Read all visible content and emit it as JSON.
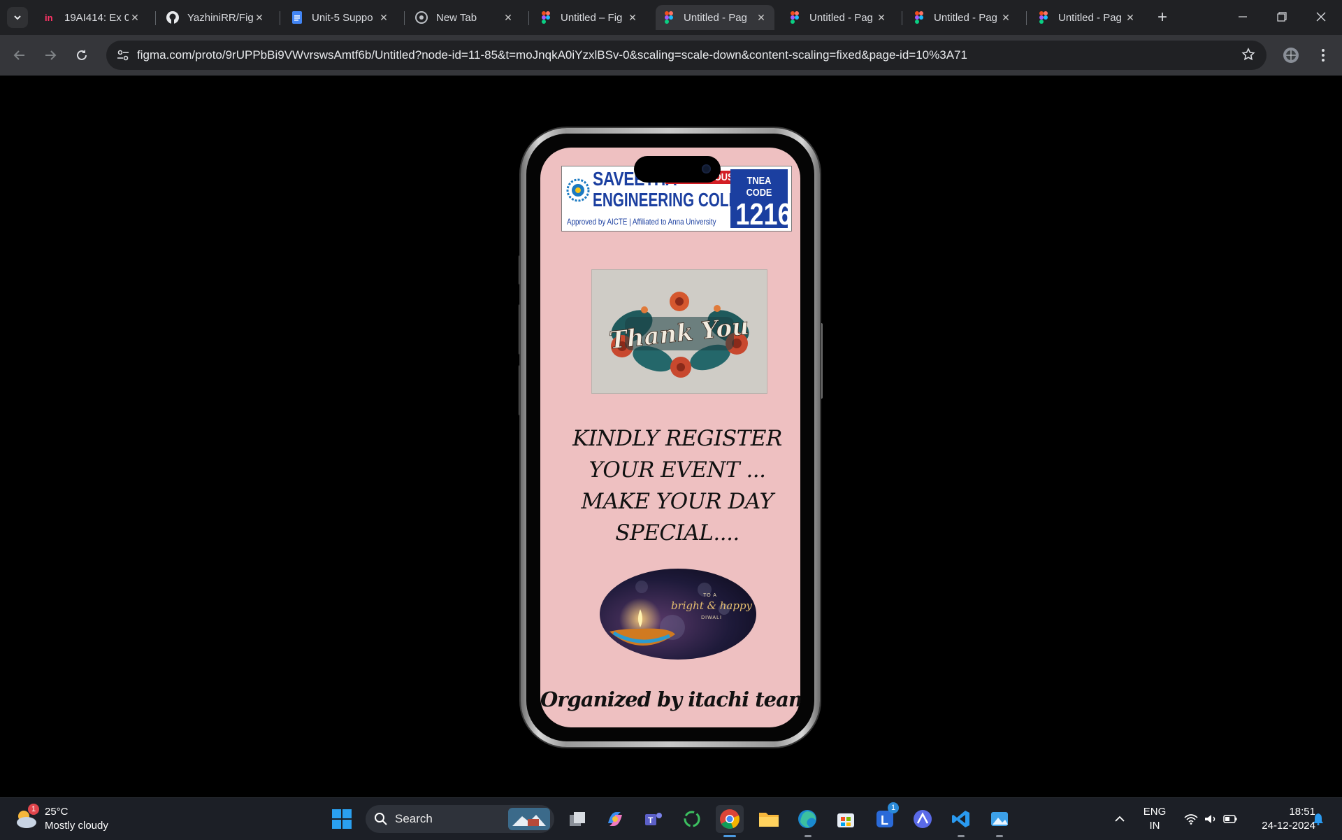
{
  "browser": {
    "tabs": [
      {
        "title": "19AI414: Ex 0",
        "icon": "invision-icon"
      },
      {
        "title": "YazhiniRR/Fig",
        "icon": "github-icon"
      },
      {
        "title": "Unit-5 Suppo",
        "icon": "docs-icon"
      },
      {
        "title": "New Tab",
        "icon": "chrome-icon"
      },
      {
        "title": "Untitled – Fig",
        "icon": "figma-icon"
      },
      {
        "title": "Untitled - Pag",
        "icon": "figma-icon",
        "active": true
      },
      {
        "title": "Untitled - Pag",
        "icon": "figma-icon"
      },
      {
        "title": "Untitled - Pag",
        "icon": "figma-icon"
      },
      {
        "title": "Untitled - Pag",
        "icon": "figma-icon"
      }
    ],
    "url": "figma.com/proto/9rUPPbBi9VWvrswsAmtf6b/Untitled?node-id=11-85&t=moJnqkA0iYzxlBSv-0&scaling=scale-down&content-scaling=fixed&page-id=10%3A71"
  },
  "prototype": {
    "banner": {
      "name_line1": "SAVEETHA",
      "autonomous": "AUTONOMOUS",
      "name_line2": "ENGINEERING COLLEGE",
      "affiliation": "Approved by AICTE | Affiliated to Anna University",
      "tnea_label": "TNEA CODE",
      "tnea_code": "1216"
    },
    "thank_you_text": "Thank You",
    "message_lines": [
      "KINDLY REGISTER",
      "YOUR EVENT ...",
      "MAKE YOUR DAY",
      "SPECIAL...."
    ],
    "diwali": {
      "to_a": "TO A",
      "greeting": "bright & happy",
      "festival": "DIWALI"
    },
    "footer": "Organized by itachi team..★"
  },
  "taskbar": {
    "weather": {
      "temp": "25°C",
      "condition": "Mostly cloudy",
      "badge": "1"
    },
    "search_label": "Search",
    "lang": {
      "line1": "ENG",
      "line2": "IN"
    },
    "time": "18:51",
    "date": "24-12-2024",
    "launcher_badge": "1"
  },
  "colors": {
    "screen_bg": "#eec0c1",
    "chrome_dark": "#202124",
    "chrome_tab": "#35363a"
  }
}
